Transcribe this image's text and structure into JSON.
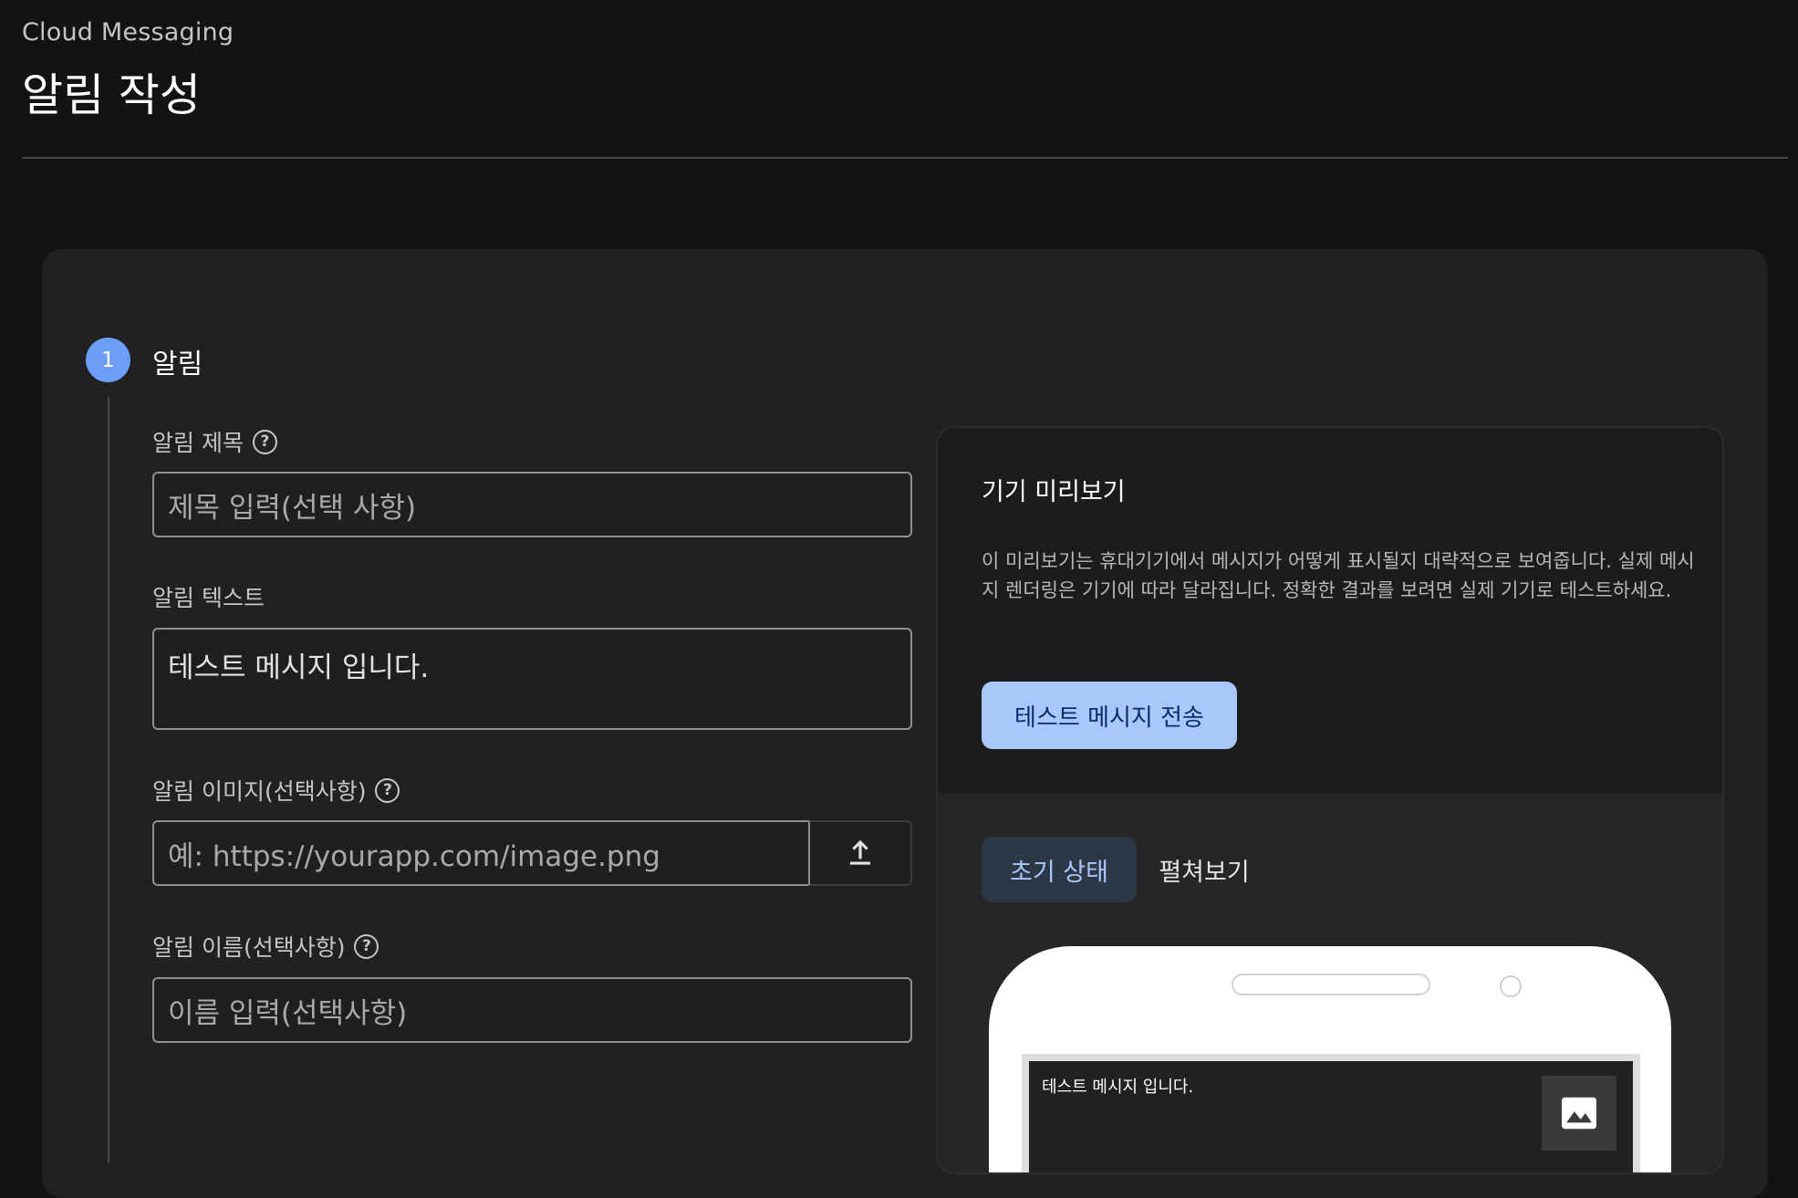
{
  "header": {
    "breadcrumb": "Cloud Messaging",
    "title": "알림 작성"
  },
  "step": {
    "number": "1",
    "title": "알림"
  },
  "form": {
    "title_label": "알림 제목",
    "title_placeholder": "제목 입력(선택 사항)",
    "text_label": "알림 텍스트",
    "text_value": "테스트 메시지 입니다.",
    "image_label": "알림 이미지(선택사항)",
    "image_placeholder": "예: https://yourapp.com/image.png",
    "name_label": "알림 이름(선택사항)",
    "name_placeholder": "이름 입력(선택사항)",
    "help_glyph": "?"
  },
  "preview": {
    "title": "기기 미리보기",
    "description": "이 미리보기는 휴대기기에서 메시지가 어떻게 표시될지 대략적으로 보여줍니다. 실제 메시지 렌더링은 기기에 따라 달라집니다. 정확한 결과를 보려면 실제 기기로 테스트하세요.",
    "send_button": "테스트 메시지 전송",
    "tabs": [
      {
        "label": "초기 상태",
        "active": true
      },
      {
        "label": "펼쳐보기",
        "active": false
      }
    ],
    "notification_text": "테스트 메시지 입니다."
  },
  "colors": {
    "accent": "#a8c7fa",
    "step_circle": "#6c9ef8"
  }
}
